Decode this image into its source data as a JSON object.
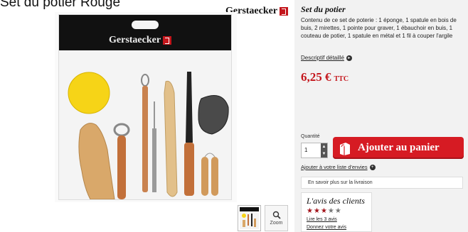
{
  "heading_fragment": "Set du potier Rouge",
  "brand": {
    "name": "Gerstaecker"
  },
  "product": {
    "title": "Set du potier",
    "description": "Contenu de ce set de poterie : 1 éponge, 1 spatule en bois de buis, 2 mirettes, 1 pointe pour graver, 1 ébauchoir en buis, 1 couteau de potier, 1 spatule en métal et 1 fil à couper l'argile",
    "details_link": "Descriptif détaillé",
    "price": "6,25 €",
    "price_suffix": "TTC"
  },
  "purchase": {
    "quantity_label": "Quantité",
    "quantity_value": "1",
    "add_to_cart_label": "Ajouter au panier"
  },
  "wishlist_label": "Ajouter à votre liste d'envies",
  "delivery_label": "En savoir plus sur la livraison",
  "reviews": {
    "title": "L'avis des clients",
    "rating": 3,
    "max_rating": 5,
    "read_label": "Lire les 3 avis",
    "give_label": "Donnez votre avis"
  },
  "gallery": {
    "zoom_label": "Zoom"
  },
  "colors": {
    "accent": "#d61b23",
    "panel": "#f2f2f2"
  }
}
